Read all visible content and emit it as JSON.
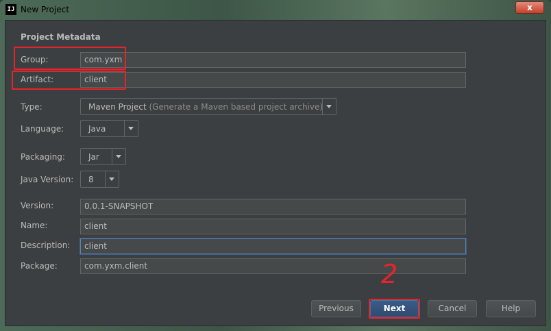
{
  "window": {
    "title": "New Project",
    "close_label": "x"
  },
  "app": {
    "icon_label": "IJ"
  },
  "section": {
    "title": "Project Metadata"
  },
  "fields": {
    "group": {
      "label": "Group:",
      "value": "com.yxm"
    },
    "artifact": {
      "label": "Artifact:",
      "value": "client"
    },
    "version": {
      "label": "Version:",
      "value": "0.0.1-SNAPSHOT"
    },
    "name": {
      "label": "Name:",
      "value": "client"
    },
    "description": {
      "label": "Description:",
      "value": "client"
    },
    "package": {
      "label": "Package:",
      "value": "com.yxm.client"
    }
  },
  "combos": {
    "type": {
      "label": "Type:",
      "value": "Maven Project",
      "hint": "(Generate a Maven based project archive)"
    },
    "language": {
      "label": "Language:",
      "value": "Java"
    },
    "packaging": {
      "label": "Packaging:",
      "value": "Jar"
    },
    "java_version": {
      "label": "Java Version:",
      "value": "8"
    }
  },
  "buttons": {
    "previous": "Previous",
    "next": "Next",
    "cancel": "Cancel",
    "help": "Help"
  },
  "annotation": {
    "text": "2",
    "color": "#e8242a"
  },
  "colors": {
    "panel": "#3c3f41",
    "field_bg": "#45494a",
    "text": "#bbbbbb",
    "accent": "#2f4b70"
  }
}
